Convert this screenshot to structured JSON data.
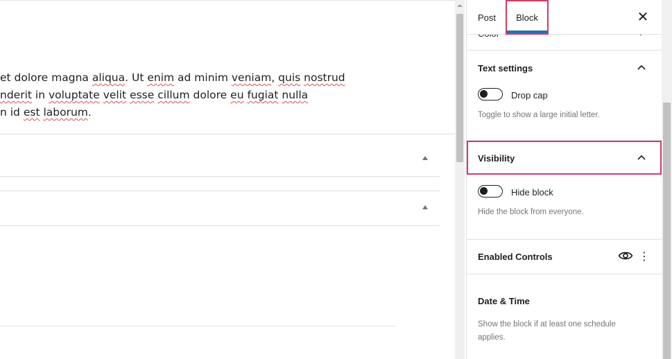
{
  "editor": {
    "paragraph_lines": [
      [
        {
          "t": "et dolore magna ",
          "sp": false
        },
        {
          "t": "aliqua",
          "sp": true
        },
        {
          "t": ". Ut ",
          "sp": false
        },
        {
          "t": "enim",
          "sp": true
        },
        {
          "t": " ad minim ",
          "sp": false
        },
        {
          "t": "veniam",
          "sp": true
        },
        {
          "t": ", ",
          "sp": false
        },
        {
          "t": "quis",
          "sp": true
        },
        {
          "t": " ",
          "sp": false
        },
        {
          "t": "nostrud",
          "sp": true
        }
      ],
      [
        {
          "t": "nderit",
          "sp": true
        },
        {
          "t": " in ",
          "sp": false
        },
        {
          "t": "voluptate",
          "sp": true
        },
        {
          "t": " ",
          "sp": false
        },
        {
          "t": "velit",
          "sp": true
        },
        {
          "t": " ",
          "sp": false
        },
        {
          "t": "esse",
          "sp": true
        },
        {
          "t": " ",
          "sp": false
        },
        {
          "t": "cillum",
          "sp": true
        },
        {
          "t": " dolore ",
          "sp": false
        },
        {
          "t": "eu",
          "sp": true
        },
        {
          "t": " ",
          "sp": false
        },
        {
          "t": "fugiat",
          "sp": true
        },
        {
          "t": " ",
          "sp": false
        },
        {
          "t": "nulla",
          "sp": true
        }
      ],
      [
        {
          "t": "n id ",
          "sp": false
        },
        {
          "t": "est",
          "sp": true
        },
        {
          "t": " ",
          "sp": false
        },
        {
          "t": "laborum",
          "sp": true
        },
        {
          "t": ".",
          "sp": false
        }
      ]
    ]
  },
  "sidebar": {
    "tabs": {
      "post": "Post",
      "block": "Block"
    },
    "close_icon": "✕",
    "color_panel": {
      "title": "Color",
      "icon": "chevron-down-icon"
    },
    "text_settings": {
      "title": "Text settings",
      "toggle_label": "Drop cap",
      "help": "Toggle to show a large initial letter.",
      "toggle_on": false
    },
    "visibility": {
      "title": "Visibility",
      "toggle_label": "Hide block",
      "help": "Hide the block from everyone.",
      "toggle_on": false
    },
    "enabled_controls": {
      "title": "Enabled Controls",
      "icons": [
        "eye-icon",
        "more-vertical-icon"
      ]
    },
    "date_time": {
      "title": "Date & Time",
      "help": "Show the block if at least one schedule applies."
    }
  },
  "colors": {
    "highlight": "#d63864",
    "tab_underline": "#2271b1",
    "text": "#1e1e1e",
    "muted": "#757575"
  }
}
